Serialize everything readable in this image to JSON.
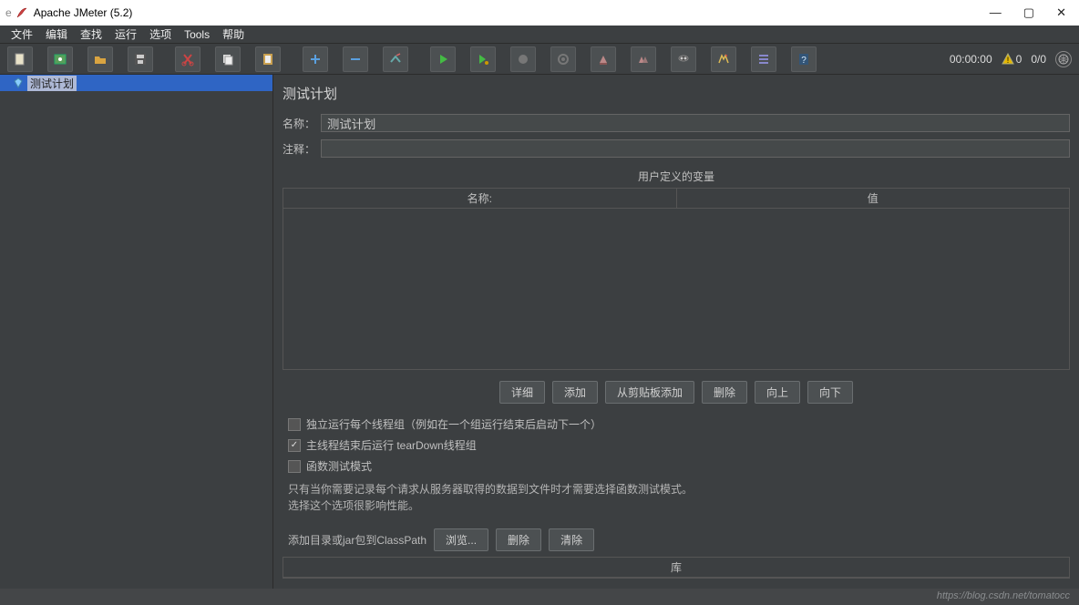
{
  "window": {
    "title": "Apache JMeter (5.2)",
    "left_mark": "e"
  },
  "menubar": [
    "文件",
    "编辑",
    "查找",
    "运行",
    "选项",
    "Tools",
    "帮助"
  ],
  "toolbar_icons": [
    "file-icon",
    "open-icon",
    "save-icon",
    "save-as-icon",
    "cut-icon",
    "copy-icon",
    "paste-icon",
    "plus-icon",
    "minus-icon",
    "wand-icon",
    "play-icon",
    "play-next-icon",
    "stop-icon",
    "stop-all-icon",
    "clear-icon",
    "clear-all-icon",
    "search-icon",
    "broom-icon",
    "list-icon",
    "help-icon"
  ],
  "status": {
    "time": "00:00:00",
    "warn_count": "0",
    "threads": "0/0"
  },
  "tree": {
    "root_label": "测试计划"
  },
  "panel": {
    "title": "测试计划",
    "name_label": "名称：",
    "name_value": "测试计划",
    "comment_label": "注释：",
    "comment_value": "",
    "vars_section": "用户定义的变量",
    "col_name": "名称:",
    "col_value": "值",
    "buttons": {
      "detail": "详细",
      "add": "添加",
      "from_clipboard": "从剪贴板添加",
      "delete": "删除",
      "up": "向上",
      "down": "向下"
    },
    "check1": "独立运行每个线程组（例如在一个组运行结束后启动下一个）",
    "check2": "主线程结束后运行 tearDown线程组",
    "check3": "函数测试模式",
    "note1": "只有当你需要记录每个请求从服务器取得的数据到文件时才需要选择函数测试模式。",
    "note2": "选择这个选项很影响性能。",
    "classpath_label": "添加目录或jar包到ClassPath",
    "browse": "浏览...",
    "delete2": "删除",
    "clear": "清除",
    "lib_col": "库"
  },
  "footer": "https://blog.csdn.net/tomatocc"
}
